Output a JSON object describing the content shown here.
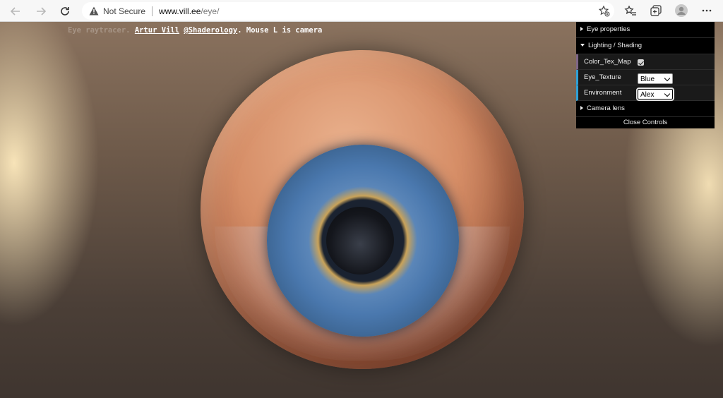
{
  "browser": {
    "security_label": "Not Secure",
    "url_host": "www.vill.ee",
    "url_path": "/eye/"
  },
  "caption": {
    "faded_prefix": "Eye raytracer. ",
    "author": "Artur Vill",
    "handle": "@Shaderology",
    "suffix": ". Mouse L is camera"
  },
  "controls": {
    "folders": {
      "eye_properties": "Eye properties",
      "lighting_shading": "Lighting / Shading",
      "camera_lens": "Camera lens"
    },
    "color_tex_map": {
      "label": "Color_Tex_Map",
      "checked": true
    },
    "eye_texture": {
      "label": "Eye_Texture",
      "value": "Blue"
    },
    "environment": {
      "label": "Environment",
      "value": "Alex"
    },
    "close_label": "Close Controls"
  },
  "colors": {
    "boolean_accent": "#806787",
    "option_accent": "#2fa1d6",
    "iris": "#4a78ae"
  }
}
